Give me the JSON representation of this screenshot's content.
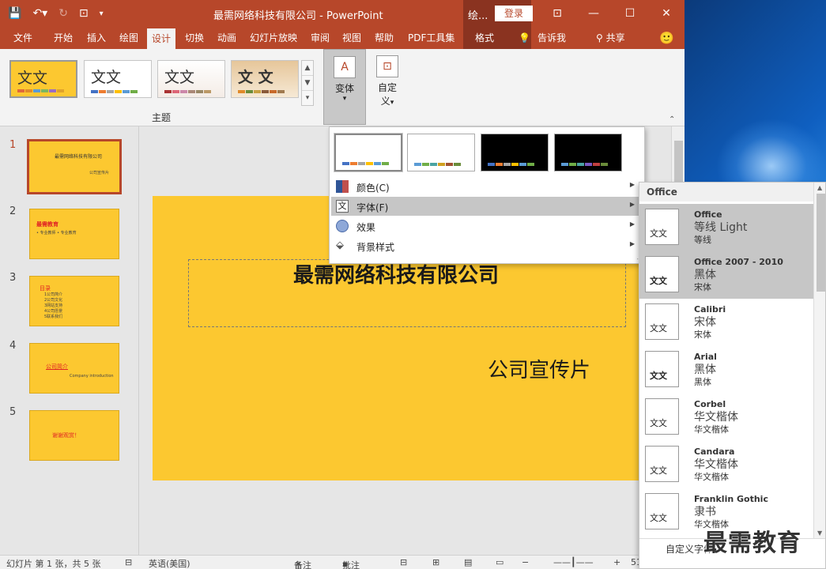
{
  "window": {
    "title": "最需网络科技有限公司  -  PowerPoint",
    "context_group": "绘...",
    "login_label": "登录",
    "min_label": "—",
    "max_label": "☐",
    "close_label": "✕",
    "ribbon_display_label": "⊡"
  },
  "tabs": [
    "文件",
    "开始",
    "插入",
    "绘图",
    "设计",
    "切换",
    "动画",
    "幻灯片放映",
    "审阅",
    "视图",
    "帮助",
    "PDF工具集",
    "格式"
  ],
  "tab_active": "设计",
  "tell_me": "告诉我",
  "share": "共享",
  "ribbon": {
    "themes_group_label": "主题",
    "theme_sample_text": "文文",
    "theme_sample_text_1": "文文",
    "theme_sample_text_2": "文文",
    "theme_sample_text_3": "文 文",
    "variants_label": "变体",
    "customize_label_1": "自定",
    "customize_label_2": "义",
    "variant_arrow": "▾",
    "customize_arrow": "▾"
  },
  "slides": [
    {
      "num": "1",
      "title": "最需网络科技有限公司",
      "sub": "公司宣传片"
    },
    {
      "num": "2",
      "title": "最需教育",
      "sub": "• 专业教师            • 专业教育"
    },
    {
      "num": "3",
      "title": "目录",
      "sub": "1公司简介\n2公司文化\n3网站支持\n4公司愿景\n5联系我们"
    },
    {
      "num": "4",
      "title": "公司简介",
      "sub": "Company introduction"
    },
    {
      "num": "5",
      "title": "谢谢观赏！",
      "sub": ""
    }
  ],
  "main_slide": {
    "title": "最需网络科技有限公司",
    "subtitle": "公司宣传片"
  },
  "variants_menu": {
    "items": [
      {
        "label": "颜色(C)",
        "icon": "color-palette-icon"
      },
      {
        "label": "字体(F)",
        "icon": "font-icon"
      },
      {
        "label": "效果",
        "icon": "effects-icon"
      },
      {
        "label": "背景样式",
        "icon": "background-style-icon"
      }
    ],
    "grip": "∴"
  },
  "fonts_menu": {
    "header": "Office",
    "preview_text": "文文",
    "items": [
      {
        "name": "Office",
        "major": "等线 Light",
        "minor": "等线"
      },
      {
        "name": "Office 2007 - 2010",
        "major": "黑体",
        "minor": "宋体"
      },
      {
        "name": "Calibri",
        "major": "宋体",
        "minor": "宋体"
      },
      {
        "name": "Arial",
        "major": "黑体",
        "minor": "黑体"
      },
      {
        "name": "Corbel",
        "major": "华文楷体",
        "minor": "华文楷体"
      },
      {
        "name": "Candara",
        "major": "华文楷体",
        "minor": "华文楷体"
      },
      {
        "name": "Franklin Gothic",
        "major": "隶书",
        "minor": "华文楷体"
      }
    ],
    "footer": "自定义字体"
  },
  "statusbar": {
    "slide_info": "幻灯片 第 1 张，共 5 张",
    "language": "英语(美国)",
    "notes": "备注",
    "comments": "批注",
    "zoom": "51%"
  },
  "watermark": "最需教育",
  "colors": {
    "accent": "#b7472a",
    "slide_bg": "#fcc830",
    "highlight": "#c6c6c6"
  }
}
